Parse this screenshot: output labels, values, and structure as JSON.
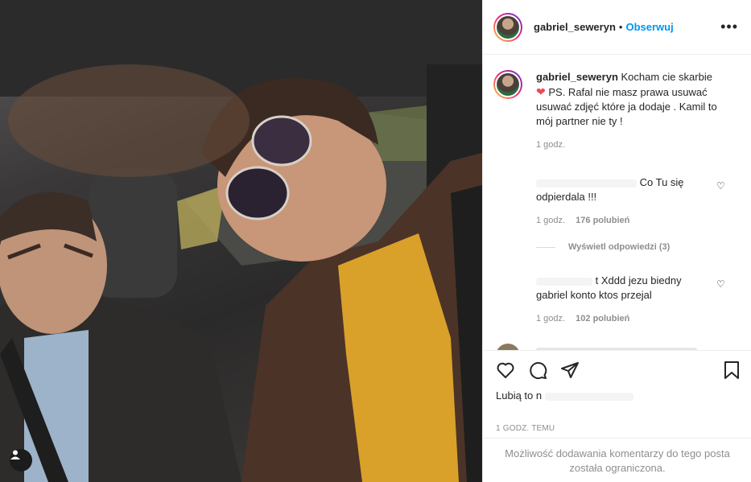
{
  "post": {
    "username": "gabriel_seweryn",
    "follow_label": "Obserwuj",
    "separator": "•",
    "more_label": "•••"
  },
  "caption": {
    "username": "gabriel_seweryn",
    "text_before": "Kocham cie skarbie",
    "text_after": "PS. Rafal nie masz prawa usuwać usuwać zdjęć które ja dodaje . Kamil to mój partner nie ty !",
    "time": "1 godz."
  },
  "comments": [
    {
      "text": "Co Tu się odpierdala !!!",
      "time": "1 godz.",
      "likes": "176 polubień"
    },
    {
      "text": "t Xddd jezu biedny gabriel konto ktos przejal",
      "time": "1 godz.",
      "likes": "102 polubień"
    }
  ],
  "replies_label": "Wyświetl odpowiedzi (3)",
  "likes_prefix": "Lubią to n",
  "timestamp": "1 GODZ. TEMU",
  "comments_limited": "Możliwość dodawania komentarzy do tego posta została ograniczona.",
  "icons": [
    "heart-icon",
    "comment-icon",
    "share-icon",
    "bookmark-icon",
    "more-options-icon",
    "user-tag-icon"
  ],
  "colors": {
    "accent": "#0095f6",
    "text": "#262626",
    "muted": "#8e8e8e",
    "heart": "#ed4956"
  }
}
